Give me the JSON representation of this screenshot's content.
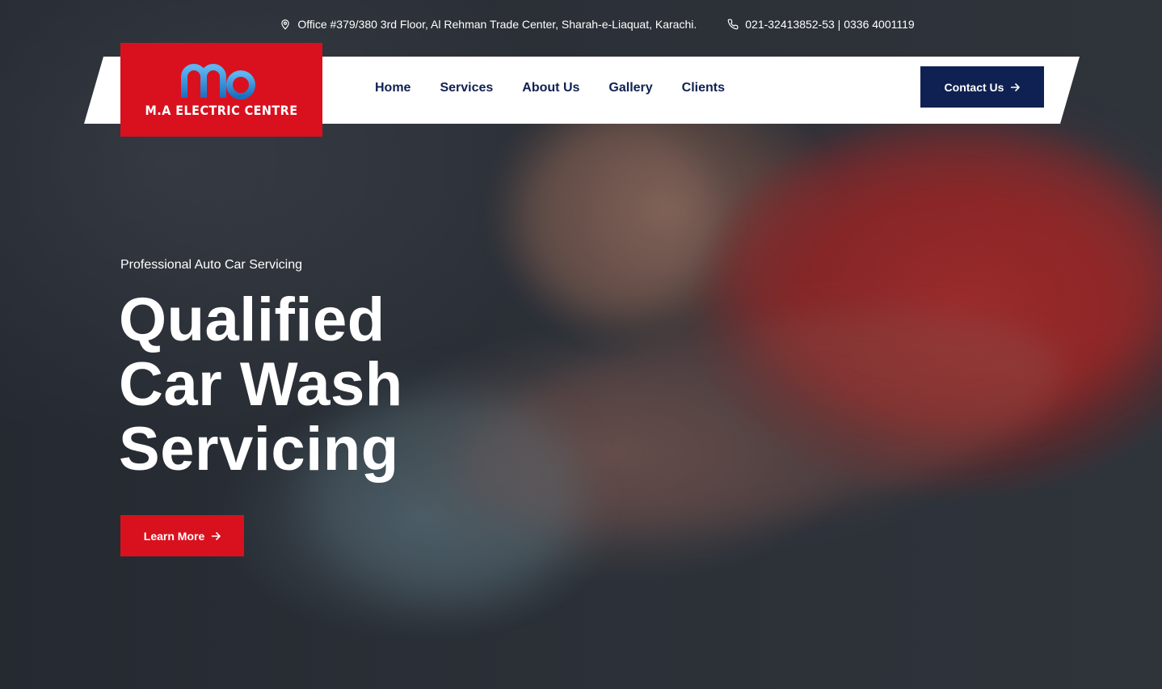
{
  "topbar": {
    "address": "Office #379/380 3rd Floor, Al Rehman Trade Center, Sharah-e-Liaquat, Karachi.",
    "address_icon": "map-pin-icon",
    "phone": "021-32413852-53 | 0336 4001119",
    "phone_icon": "phone-icon"
  },
  "logo": {
    "mark": "ma",
    "text": "M.A ELECTRIC CENTRE"
  },
  "nav": {
    "items": [
      {
        "label": "Home"
      },
      {
        "label": "Services"
      },
      {
        "label": "About Us"
      },
      {
        "label": "Gallery"
      },
      {
        "label": "Clients"
      }
    ],
    "contact_label": "Contact Us",
    "contact_icon": "arrow-right-icon"
  },
  "hero": {
    "eyebrow": "Professional Auto Car Servicing",
    "headline": [
      "Qualified",
      "Car Wash",
      "Servicing"
    ],
    "button_label": "Learn More",
    "button_icon": "arrow-right-icon"
  },
  "colors": {
    "brand_red": "#d9111e",
    "brand_navy": "#0f2152",
    "logo_blue": "#2a8fd8"
  }
}
